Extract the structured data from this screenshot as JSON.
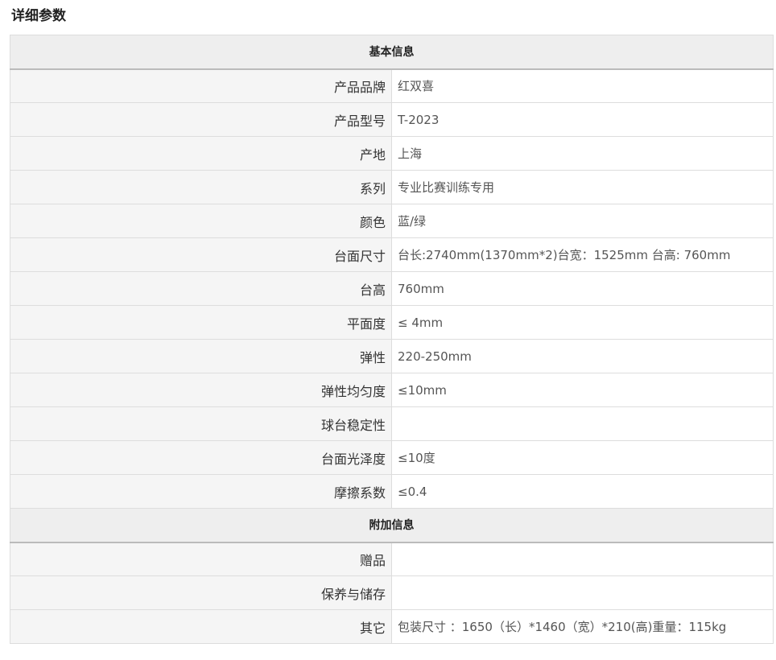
{
  "page_title": "详细参数",
  "sections": [
    {
      "title": "基本信息",
      "rows": [
        {
          "label": "产品品牌",
          "value": "红双喜"
        },
        {
          "label": "产品型号",
          "value": "T-2023"
        },
        {
          "label": "产地",
          "value": "上海"
        },
        {
          "label": "系列",
          "value": "专业比赛训练专用"
        },
        {
          "label": "颜色",
          "value": "蓝/绿"
        },
        {
          "label": "台面尺寸",
          "value": "台长:2740mm(1370mm*2)台宽：1525mm 台高: 760mm"
        },
        {
          "label": "台高",
          "value": "760mm"
        },
        {
          "label": "平面度",
          "value": "≤ 4mm"
        },
        {
          "label": "弹性",
          "value": "220-250mm"
        },
        {
          "label": "弹性均匀度",
          "value": "≤10mm"
        },
        {
          "label": "球台稳定性",
          "value": ""
        },
        {
          "label": "台面光泽度",
          "value": "≤10度"
        },
        {
          "label": "摩擦系数",
          "value": "≤0.4"
        }
      ]
    },
    {
      "title": "附加信息",
      "rows": [
        {
          "label": "赠品",
          "value": ""
        },
        {
          "label": "保养与储存",
          "value": ""
        },
        {
          "label": "其它",
          "value": "包装尺寸 ：1650（长）*1460（宽）*210(高)重量：115kg"
        }
      ]
    }
  ]
}
